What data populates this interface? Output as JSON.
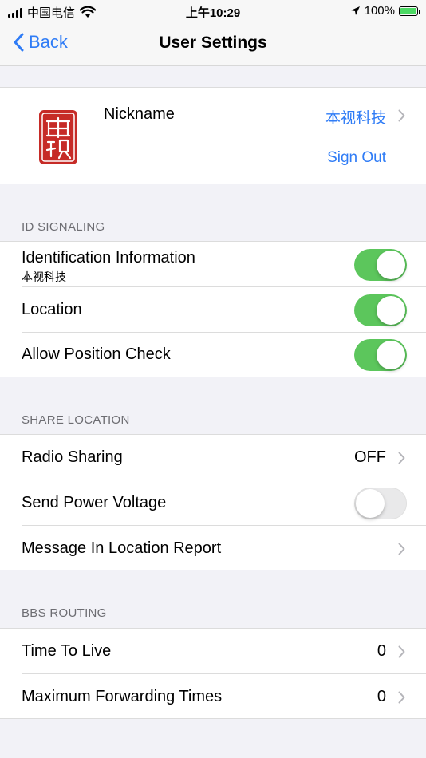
{
  "status_bar": {
    "carrier": "中国电信",
    "time": "上午10:29",
    "battery": "100%"
  },
  "nav": {
    "back_label": "Back",
    "title": "User Settings"
  },
  "profile": {
    "nickname_label": "Nickname",
    "nickname_value": "本视科技",
    "sign_out_label": "Sign Out"
  },
  "id_signaling": {
    "header": "ID SIGNALING",
    "identification_label": "Identification Information",
    "identification_sub": "本视科技",
    "identification_on": true,
    "location_label": "Location",
    "location_on": true,
    "position_check_label": "Allow Position Check",
    "position_check_on": true
  },
  "share_location": {
    "header": "SHARE LOCATION",
    "radio_sharing_label": "Radio Sharing",
    "radio_sharing_value": "OFF",
    "power_voltage_label": "Send Power Voltage",
    "power_voltage_on": false,
    "message_report_label": "Message In Location Report"
  },
  "bbs_routing": {
    "header": "BBS ROUTING",
    "ttl_label": "Time To Live",
    "ttl_value": "0",
    "max_forward_label": "Maximum Forwarding Times",
    "max_forward_value": "0"
  },
  "colors": {
    "accent": "#2f7cf6",
    "toggle_on": "#5cc65c",
    "background": "#f2f2f7",
    "seal_red": "#c62b27"
  }
}
